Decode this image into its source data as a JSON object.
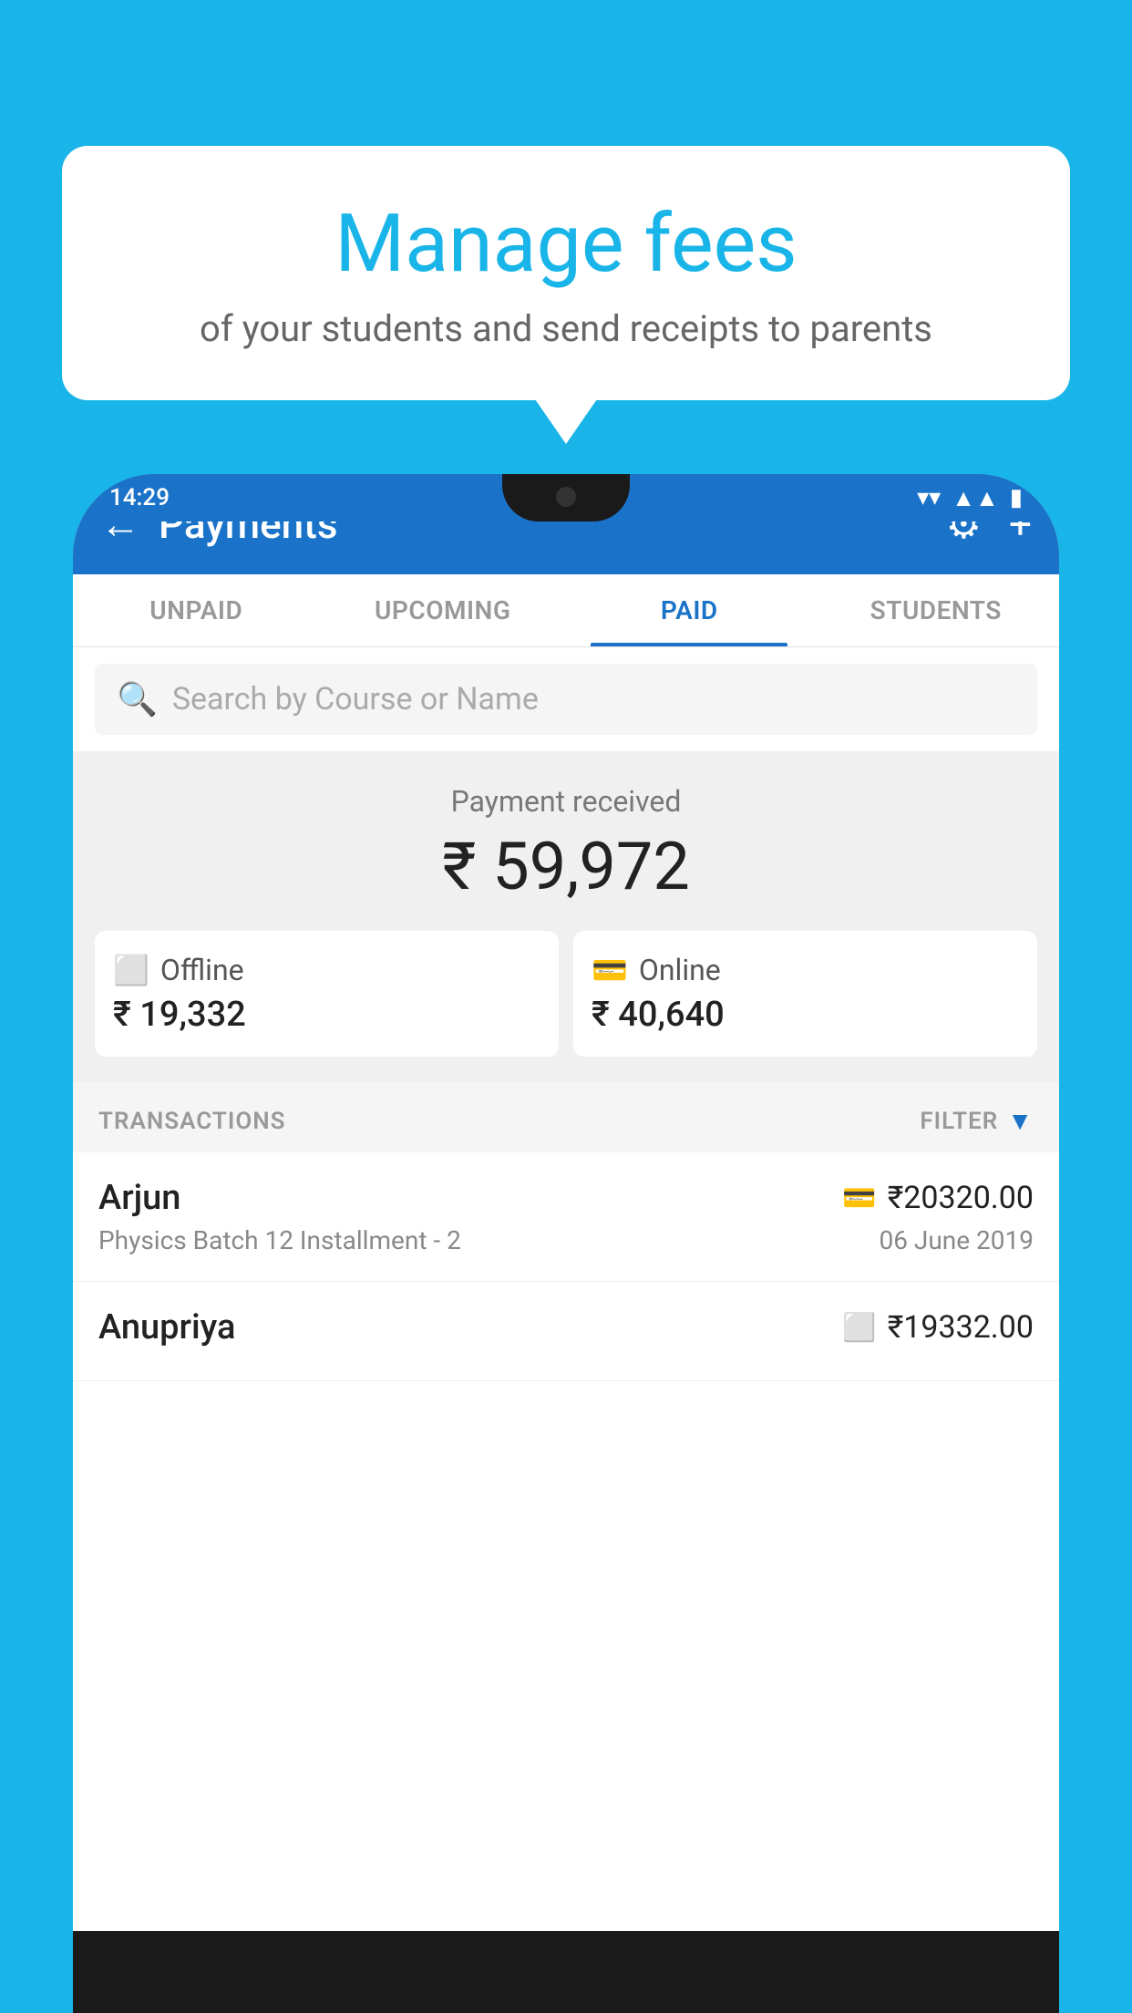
{
  "background_color": "#1ab5e8",
  "bubble": {
    "title": "Manage fees",
    "subtitle": "of your students and send receipts to parents"
  },
  "status_bar": {
    "time": "14:29",
    "wifi": "▲",
    "signal": "▲",
    "battery": "▮"
  },
  "app_bar": {
    "title": "Payments",
    "back_label": "←",
    "gear_label": "⚙",
    "plus_label": "+"
  },
  "tabs": [
    {
      "id": "unpaid",
      "label": "UNPAID",
      "active": false
    },
    {
      "id": "upcoming",
      "label": "UPCOMING",
      "active": false
    },
    {
      "id": "paid",
      "label": "PAID",
      "active": true
    },
    {
      "id": "students",
      "label": "STUDENTS",
      "active": false
    }
  ],
  "search": {
    "placeholder": "Search by Course or Name"
  },
  "payment_summary": {
    "label": "Payment received",
    "amount": "₹ 59,972",
    "offline_label": "Offline",
    "offline_amount": "₹ 19,332",
    "online_label": "Online",
    "online_amount": "₹ 40,640"
  },
  "transactions_section": {
    "label": "TRANSACTIONS",
    "filter_label": "FILTER"
  },
  "transactions": [
    {
      "name": "Arjun",
      "course": "Physics Batch 12 Installment - 2",
      "amount": "₹20320.00",
      "date": "06 June 2019",
      "payment_type": "online"
    },
    {
      "name": "Anupriya",
      "course": "",
      "amount": "₹19332.00",
      "date": "",
      "payment_type": "offline"
    }
  ]
}
